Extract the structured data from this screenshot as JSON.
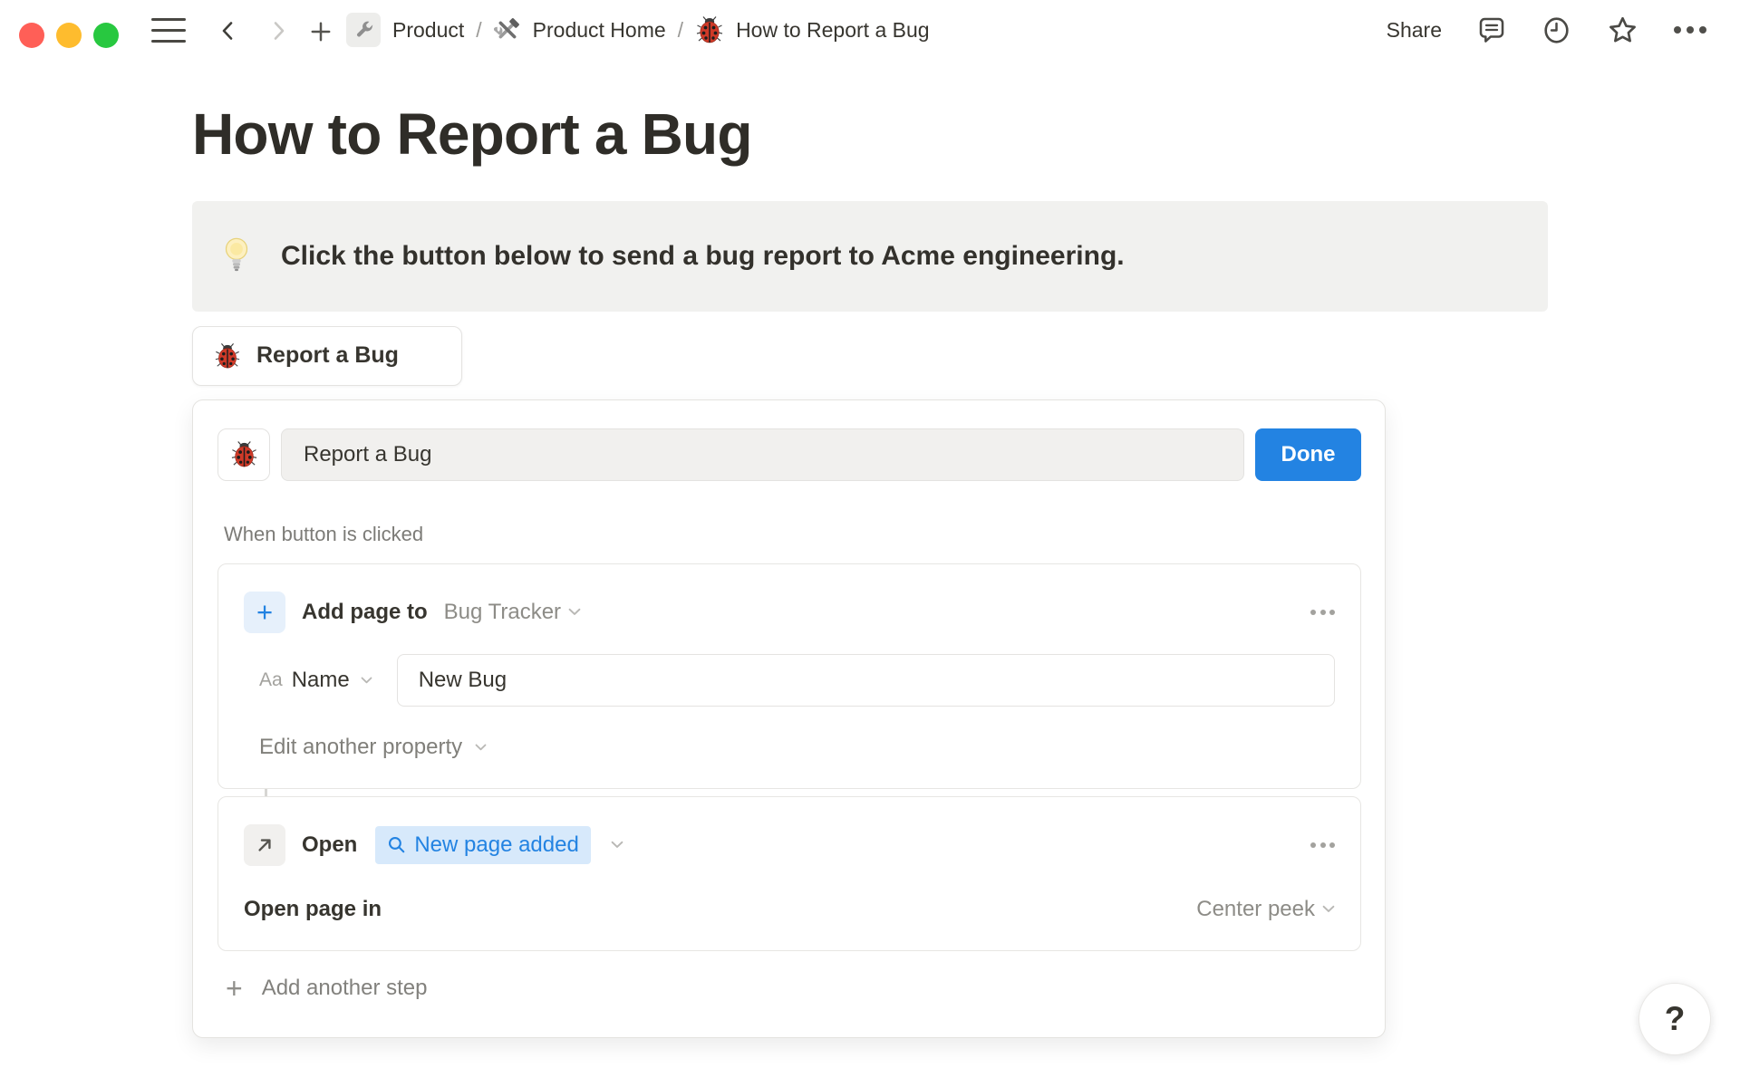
{
  "colors": {
    "accent": "#2383e2",
    "traffic_red": "#ff5f57",
    "traffic_yellow": "#febc2e",
    "traffic_green": "#28c840",
    "callout_bg": "#f1f1ef",
    "token_bg": "#d7e9fb"
  },
  "topbar": {
    "separator": "/",
    "breadcrumb": [
      {
        "icon": "wrench-icon",
        "label": "Product"
      },
      {
        "icon": "hammer-wrench-icon",
        "label": "Product Home"
      },
      {
        "icon": "ladybug-icon",
        "label": "How to Report a Bug"
      }
    ],
    "share_label": "Share"
  },
  "icons": {
    "topbar_left": [
      "menu-icon",
      "back-icon",
      "forward-icon",
      "new-page-icon"
    ],
    "topbar_right": [
      "comment-icon",
      "clock-icon",
      "star-icon",
      "more-icon"
    ],
    "callout": "light-bulb-icon",
    "step1": "plus-icon",
    "step2": "open-arrow-icon",
    "token": "search-icon",
    "help": "question-icon"
  },
  "page": {
    "title": "How to Report a Bug",
    "callout_text": "Click the button below to send a bug report to Acme engineering.",
    "button_label": "Report a Bug"
  },
  "editor": {
    "button_name_value": "Report a Bug",
    "done_label": "Done",
    "trigger_label": "When button is clicked",
    "step1": {
      "action": "Add page to",
      "target": "Bug Tracker",
      "property_type": "Aa",
      "property_name": "Name",
      "value": "New Bug",
      "footer": "Edit another property"
    },
    "step2": {
      "action": "Open",
      "token": "New page added",
      "row_label": "Open page in",
      "row_value": "Center peek"
    },
    "add_step_label": "Add another step"
  },
  "help": {
    "label": "?"
  }
}
